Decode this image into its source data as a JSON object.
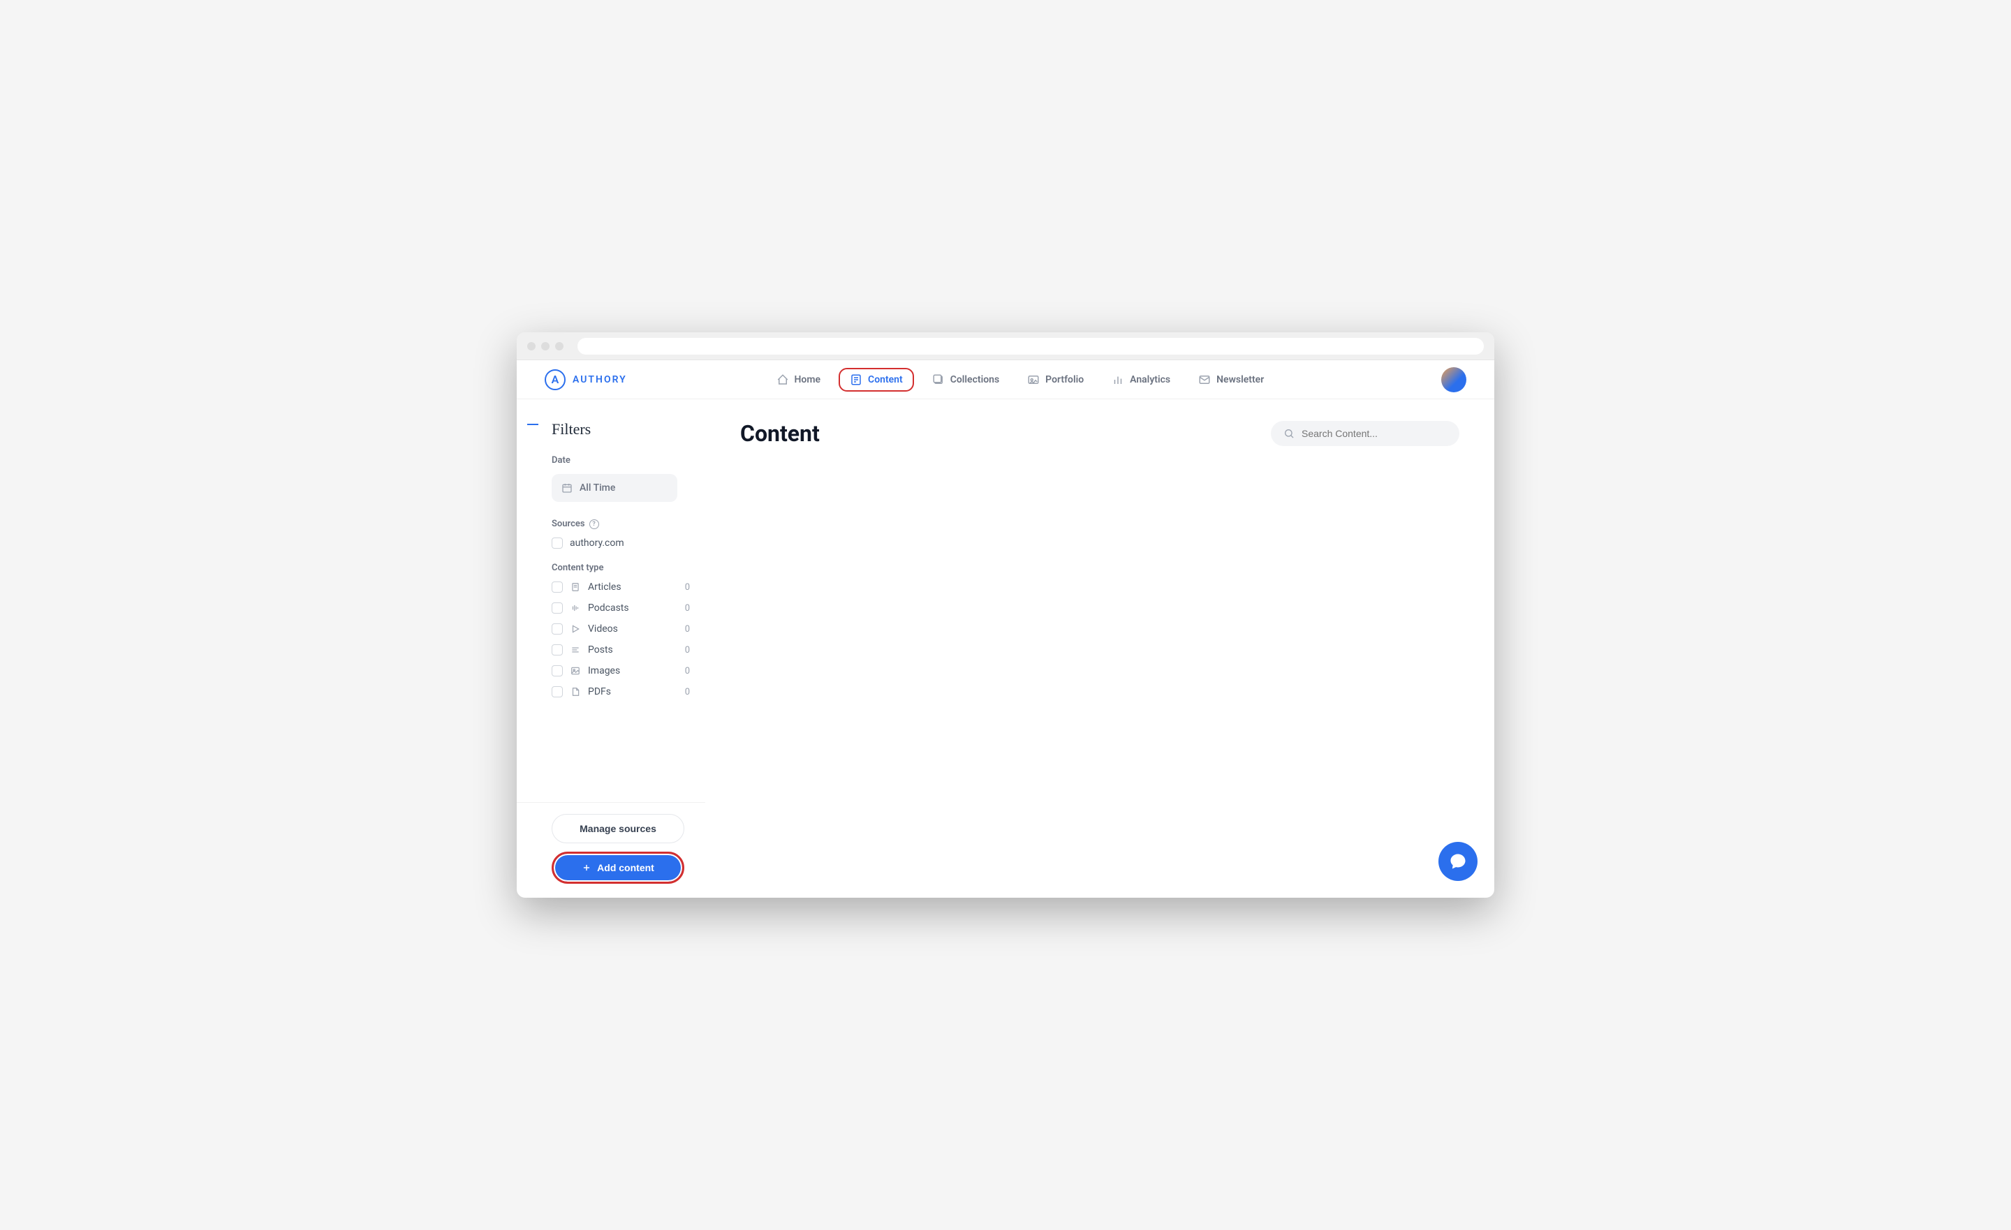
{
  "brand": {
    "name": "AUTHORY"
  },
  "nav": {
    "items": [
      {
        "label": "Home",
        "icon": "home-icon",
        "active": false
      },
      {
        "label": "Content",
        "icon": "content-icon",
        "active": true
      },
      {
        "label": "Collections",
        "icon": "collections-icon",
        "active": false
      },
      {
        "label": "Portfolio",
        "icon": "portfolio-icon",
        "active": false
      },
      {
        "label": "Analytics",
        "icon": "analytics-icon",
        "active": false
      },
      {
        "label": "Newsletter",
        "icon": "newsletter-icon",
        "active": false
      }
    ]
  },
  "page": {
    "title": "Content"
  },
  "search": {
    "placeholder": "Search Content..."
  },
  "filters": {
    "title": "Filters",
    "date_label": "Date",
    "date_value": "All Time",
    "sources_label": "Sources",
    "sources": [
      {
        "label": "authory.com"
      }
    ],
    "type_label": "Content type",
    "types": [
      {
        "label": "Articles",
        "count": "0",
        "icon": "article-icon"
      },
      {
        "label": "Podcasts",
        "count": "0",
        "icon": "podcast-icon"
      },
      {
        "label": "Videos",
        "count": "0",
        "icon": "video-icon"
      },
      {
        "label": "Posts",
        "count": "0",
        "icon": "post-icon"
      },
      {
        "label": "Images",
        "count": "0",
        "icon": "image-icon"
      },
      {
        "label": "PDFs",
        "count": "0",
        "icon": "pdf-icon"
      }
    ]
  },
  "buttons": {
    "manage_sources": "Manage sources",
    "add_content": "Add content"
  }
}
